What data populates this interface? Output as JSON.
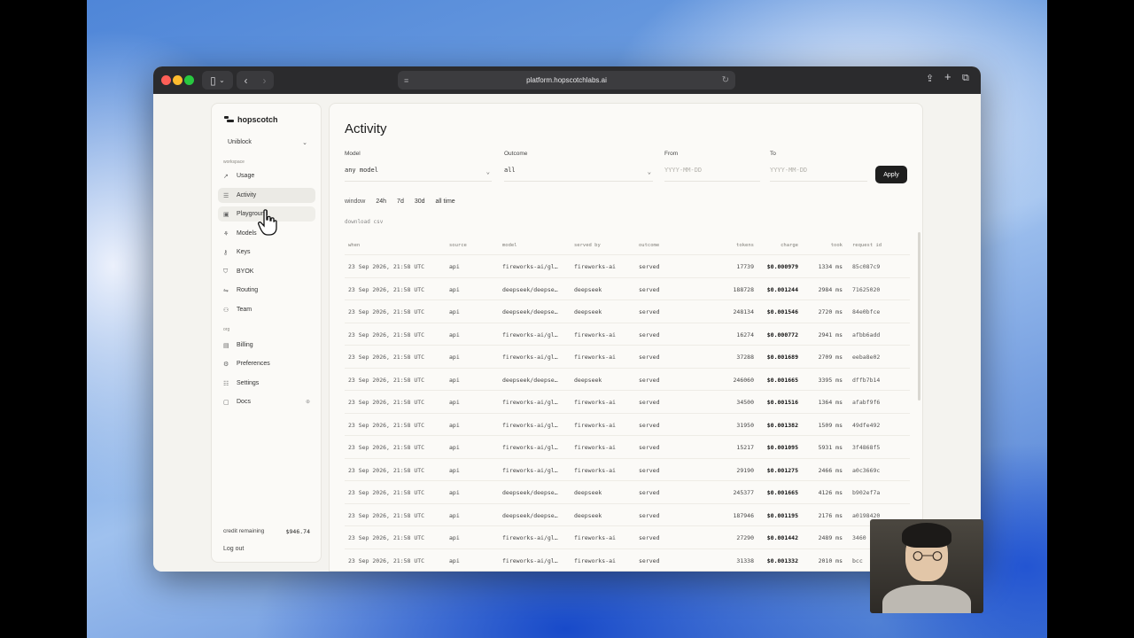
{
  "browser": {
    "url": "platform.hopscotchlabs.ai"
  },
  "sidebar": {
    "brand": "hopscotch",
    "workspace": "Uniblock",
    "section_workspace": "workspace",
    "items": [
      {
        "label": "Usage",
        "icon": "chart-icon"
      },
      {
        "label": "Activity",
        "icon": "list-icon"
      },
      {
        "label": "Playground",
        "icon": "play-icon"
      },
      {
        "label": "Models",
        "icon": "models-icon"
      },
      {
        "label": "Keys",
        "icon": "key-icon"
      },
      {
        "label": "BYOK",
        "icon": "shield-icon"
      },
      {
        "label": "Routing",
        "icon": "routing-icon"
      },
      {
        "label": "Team",
        "icon": "team-icon"
      }
    ],
    "section_org": "org",
    "org_items": [
      {
        "label": "Billing",
        "icon": "billing-icon"
      },
      {
        "label": "Preferences",
        "icon": "preferences-icon"
      },
      {
        "label": "Settings",
        "icon": "settings-icon"
      },
      {
        "label": "Docs",
        "icon": "docs-icon"
      }
    ],
    "credit_label": "credit remaining",
    "credit_amount": "$946.74",
    "logout": "Log out"
  },
  "main": {
    "title": "Activity",
    "filters": {
      "model_label": "Model",
      "model_value": "any model",
      "outcome_label": "Outcome",
      "outcome_value": "all",
      "from_label": "From",
      "from_placeholder": "YYYY-MM-DD",
      "to_label": "To",
      "to_placeholder": "YYYY-MM-DD",
      "apply": "Apply"
    },
    "window": {
      "label": "window",
      "options": [
        "24h",
        "7d",
        "30d",
        "all time"
      ]
    },
    "download": "download csv",
    "columns": [
      "when",
      "source",
      "model",
      "served by",
      "outcome",
      "tokens",
      "charge",
      "took",
      "request id"
    ],
    "rows": [
      {
        "when": "23 Sep 2026, 21:58 UTC",
        "source": "api",
        "model": "fireworks-ai/gl…",
        "served": "fireworks-ai",
        "outcome": "served",
        "tokens": "17739",
        "charge": "$0.000979",
        "took": "1334 ms",
        "id": "85c087c9"
      },
      {
        "when": "23 Sep 2026, 21:58 UTC",
        "source": "api",
        "model": "deepseek/deepse…",
        "served": "deepseek",
        "outcome": "served",
        "tokens": "188728",
        "charge": "$0.001244",
        "took": "2984 ms",
        "id": "71625020"
      },
      {
        "when": "23 Sep 2026, 21:58 UTC",
        "source": "api",
        "model": "deepseek/deepse…",
        "served": "deepseek",
        "outcome": "served",
        "tokens": "248134",
        "charge": "$0.001546",
        "took": "2720 ms",
        "id": "84e0bfce"
      },
      {
        "when": "23 Sep 2026, 21:58 UTC",
        "source": "api",
        "model": "fireworks-ai/gl…",
        "served": "fireworks-ai",
        "outcome": "served",
        "tokens": "16274",
        "charge": "$0.000772",
        "took": "2941 ms",
        "id": "afbb6add"
      },
      {
        "when": "23 Sep 2026, 21:58 UTC",
        "source": "api",
        "model": "fireworks-ai/gl…",
        "served": "fireworks-ai",
        "outcome": "served",
        "tokens": "37288",
        "charge": "$0.001689",
        "took": "2709 ms",
        "id": "eeba8e02"
      },
      {
        "when": "23 Sep 2026, 21:58 UTC",
        "source": "api",
        "model": "deepseek/deepse…",
        "served": "deepseek",
        "outcome": "served",
        "tokens": "246060",
        "charge": "$0.001665",
        "took": "3395 ms",
        "id": "dffb7b14"
      },
      {
        "when": "23 Sep 2026, 21:58 UTC",
        "source": "api",
        "model": "fireworks-ai/gl…",
        "served": "fireworks-ai",
        "outcome": "served",
        "tokens": "34500",
        "charge": "$0.001516",
        "took": "1364 ms",
        "id": "afabf9f6"
      },
      {
        "when": "23 Sep 2026, 21:58 UTC",
        "source": "api",
        "model": "fireworks-ai/gl…",
        "served": "fireworks-ai",
        "outcome": "served",
        "tokens": "31950",
        "charge": "$0.001382",
        "took": "1509 ms",
        "id": "49dfe492"
      },
      {
        "when": "23 Sep 2026, 21:58 UTC",
        "source": "api",
        "model": "fireworks-ai/gl…",
        "served": "fireworks-ai",
        "outcome": "served",
        "tokens": "15217",
        "charge": "$0.001095",
        "took": "5931 ms",
        "id": "3f4868f5"
      },
      {
        "when": "23 Sep 2026, 21:58 UTC",
        "source": "api",
        "model": "fireworks-ai/gl…",
        "served": "fireworks-ai",
        "outcome": "served",
        "tokens": "29190",
        "charge": "$0.001275",
        "took": "2466 ms",
        "id": "a0c3669c"
      },
      {
        "when": "23 Sep 2026, 21:58 UTC",
        "source": "api",
        "model": "deepseek/deepse…",
        "served": "deepseek",
        "outcome": "served",
        "tokens": "245377",
        "charge": "$0.001665",
        "took": "4126 ms",
        "id": "b902ef7a"
      },
      {
        "when": "23 Sep 2026, 21:58 UTC",
        "source": "api",
        "model": "deepseek/deepse…",
        "served": "deepseek",
        "outcome": "served",
        "tokens": "187946",
        "charge": "$0.001195",
        "took": "2176 ms",
        "id": "a0198420"
      },
      {
        "when": "23 Sep 2026, 21:58 UTC",
        "source": "api",
        "model": "fireworks-ai/gl…",
        "served": "fireworks-ai",
        "outcome": "served",
        "tokens": "27290",
        "charge": "$0.001442",
        "took": "2489 ms",
        "id": "3460"
      },
      {
        "when": "23 Sep 2026, 21:58 UTC",
        "source": "api",
        "model": "fireworks-ai/gl…",
        "served": "fireworks-ai",
        "outcome": "served",
        "tokens": "31338",
        "charge": "$0.001332",
        "took": "2010 ms",
        "id": "bcc"
      }
    ]
  }
}
